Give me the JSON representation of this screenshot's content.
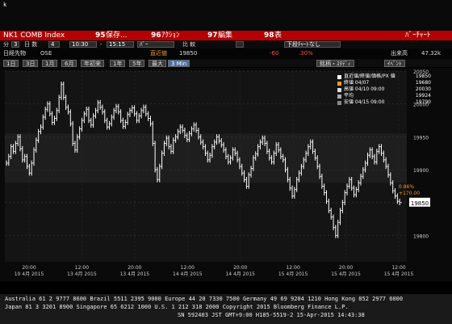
{
  "window": {
    "glyphs": [
      "k",
      "(",
      ",",
      "|",
      ":"
    ]
  },
  "title_bar": {
    "security": "NK1 COMB Index",
    "menu1_num": "95",
    "menu1_label": "保存...",
    "menu2_num": "96",
    "menu2_label": "ｱｸｼｮﾝ",
    "menu3_num": "97",
    "menu3_label": "編集",
    "menu4_num": "98",
    "menu4_label": "表",
    "right_label": "ﾊﾞｰﾁｬｰﾄ"
  },
  "row2": {
    "period_label": "分",
    "period_value": "3",
    "days_label": "日 数",
    "days_value": "4",
    "time_from": "10:30",
    "time_sep": "-",
    "time_to": "15:15",
    "type_value": "ﾊﾞｰ",
    "compare_label": "比 較",
    "style_value": "下段ﾁｬｰﾄなし"
  },
  "row3": {
    "name": "日経先物",
    "exchange": "OSE",
    "last_label": "直近値",
    "last_value": "19850",
    "change": "-60",
    "change_pct": ".30%",
    "volume_label": "出来高",
    "volume_value": "47.32k"
  },
  "row4": {
    "buttons": [
      "1日",
      "3日",
      "1月",
      "6月",
      "年初来",
      "1年",
      "5年",
      "最大"
    ],
    "active_button": "3 Min",
    "study_label": "銘柄・ｽﾀﾃﾞｨ",
    "event_label": "ｲﾍﾞﾝﾄ"
  },
  "legend": {
    "items": [
      {
        "label": "直近値/終値/価格/PX 値",
        "value": "19850"
      },
      {
        "label": "終値 04/07",
        "value": "19680"
      },
      {
        "label": "高値 04/10 09:00",
        "value": "20030"
      },
      {
        "label": "平均",
        "value": "19924"
      },
      {
        "label": "安値 04/15 09:00",
        "value": "19790"
      }
    ]
  },
  "chart_data": {
    "type": "bar",
    "ylim": [
      19760,
      20050
    ],
    "y_ticks": [
      19800,
      19850,
      19900,
      19950,
      20000,
      20050
    ],
    "last_price_tag": "19850",
    "annotation_pct": "0.86%",
    "annotation_abs": "+170.00",
    "x_ticks": [
      {
        "time": "20:00",
        "date": "10 4月 2015"
      },
      {
        "time": "12:00",
        "date": "13 4月 2015"
      },
      {
        "time": "20:00",
        "date": "13 4月 2015"
      },
      {
        "time": "12:00",
        "date": "14 4月 2015"
      },
      {
        "time": "20:00",
        "date": "14 4月 2015"
      },
      {
        "time": "12:00",
        "date": "15 4月 2015"
      },
      {
        "time": "20:00",
        "date": "15 4月 2015"
      },
      {
        "time": "12:00",
        "date": "15 4月 2015"
      }
    ],
    "series": [
      {
        "values": [
          19910,
          19920,
          19935,
          19928,
          19940,
          19950,
          19932,
          19915,
          19920,
          19905,
          19895,
          19910,
          19930,
          19945,
          19958,
          19965,
          19980,
          19992,
          20000,
          19985,
          19972,
          19978,
          19990,
          20010,
          20030,
          20010,
          19995,
          19988,
          19970,
          19940,
          19930,
          19950,
          19962,
          19975,
          19985,
          19992,
          19975,
          19968,
          19982,
          19990,
          20002,
          19995,
          19988,
          19975,
          19965,
          19970,
          19980,
          19990,
          19996,
          19988,
          19975,
          19966,
          19972,
          19984,
          19990,
          19994,
          19985,
          19975,
          19982,
          19990,
          19995,
          19985,
          19978,
          19970,
          19940,
          19900,
          19885,
          19905,
          19925,
          19940,
          19948,
          19935,
          19928,
          19945,
          19950,
          19958,
          19965,
          19960,
          19952,
          19946,
          19955,
          19962,
          19968,
          19960,
          19950,
          19942,
          19935,
          19925,
          19915,
          19922,
          19935,
          19942,
          19950,
          19944,
          19938,
          19930,
          19920,
          19912,
          19918,
          19930,
          19925,
          19915,
          19905,
          19895,
          19885,
          19875,
          19892,
          19902,
          19918,
          19924,
          19935,
          19942,
          19948,
          19940,
          19928,
          19918,
          19912,
          19925,
          19938,
          19930,
          19920,
          19915,
          19900,
          19885,
          19872,
          19860,
          19870,
          19885,
          19895,
          19905,
          19915,
          19925,
          19935,
          19942,
          19928,
          19918,
          19905,
          19890,
          19875,
          19865,
          19852,
          19838,
          19828,
          19812,
          19800,
          19820,
          19838,
          19850,
          19865,
          19875,
          19885,
          19872,
          19862,
          19870,
          19880,
          19890,
          19900,
          19910,
          19922,
          19930,
          19920,
          19912,
          19928,
          19935,
          19925,
          19915,
          19905,
          19892,
          19880,
          19868,
          19860,
          19852,
          19850
        ]
      }
    ]
  },
  "footer": {
    "line1": "Australia 61 2 9777 8600 Brazil 5511 2395 9000 Europe 44 20 7330 7500 Germany 49 69 9204 1210 Hong Kong 852 2977 6000",
    "line2": "Japan 81 3 3201 8900        Singapore 65 6212 1000        U.S. 1 212 318 2000      Copyright 2015 Bloomberg Finance L.P.",
    "line3": "SN 592403 JST  GMT+9:00 H185-5519-2 15-Apr-2015 14:43:38"
  },
  "colors": {
    "title_bar": "#b30000",
    "accent": "#f59a1e",
    "negative": "#ff4a4a",
    "bars": "#ffffff"
  }
}
